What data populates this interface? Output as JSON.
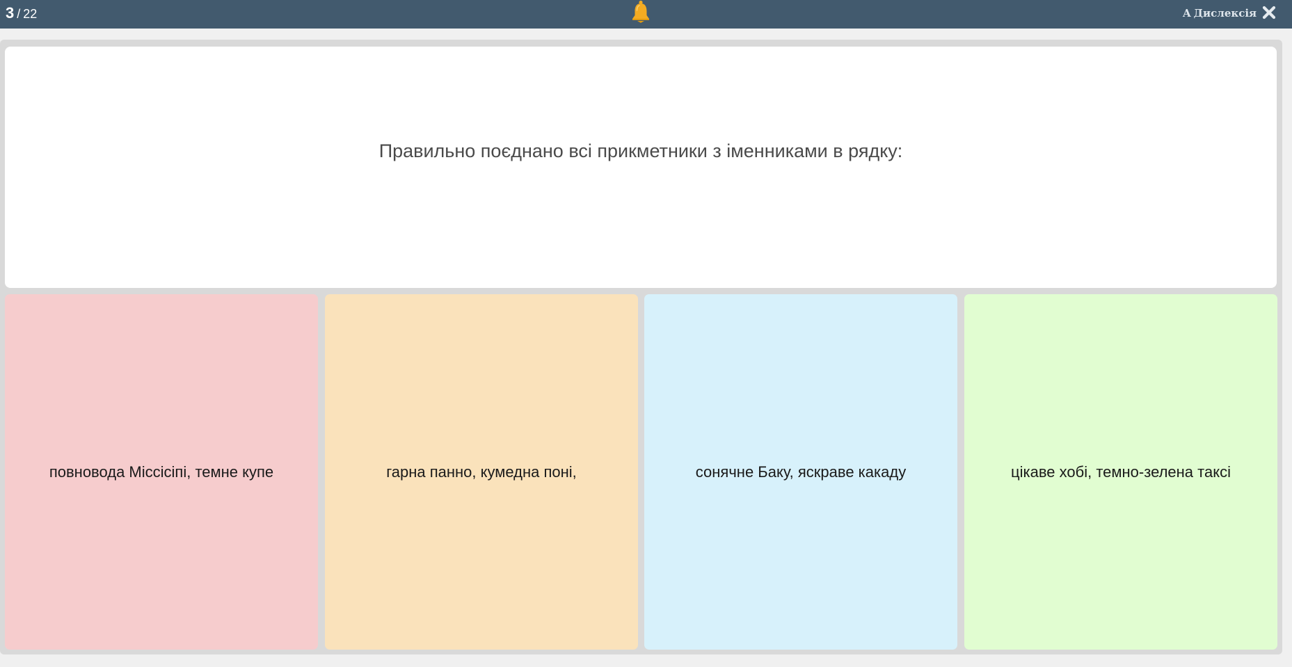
{
  "topbar": {
    "current": "3",
    "separator": "/",
    "total": "22",
    "dyslexia_glyph": "A",
    "dyslexia_label": "Дислексія",
    "bell_icon": "bell-icon",
    "close_icon": "close-icon"
  },
  "question": {
    "text": "Правильно поєднано всі прикметники з іменниками в рядку:"
  },
  "answers": [
    {
      "text": "повновода Міссісіпі, темне купе",
      "color": "#f6cccd"
    },
    {
      "text": "гарна панно, кумедна поні,",
      "color": "#fae2bb"
    },
    {
      "text": "сонячне Баку, яскраве какаду",
      "color": "#d7f1fb"
    },
    {
      "text": "цікаве хобі, темно-зелена таксі",
      "color": "#e1fdd1"
    }
  ],
  "colors": {
    "topbar": "#425a6e",
    "bell": "#f3ab22",
    "stage": "#d9d9d9"
  }
}
